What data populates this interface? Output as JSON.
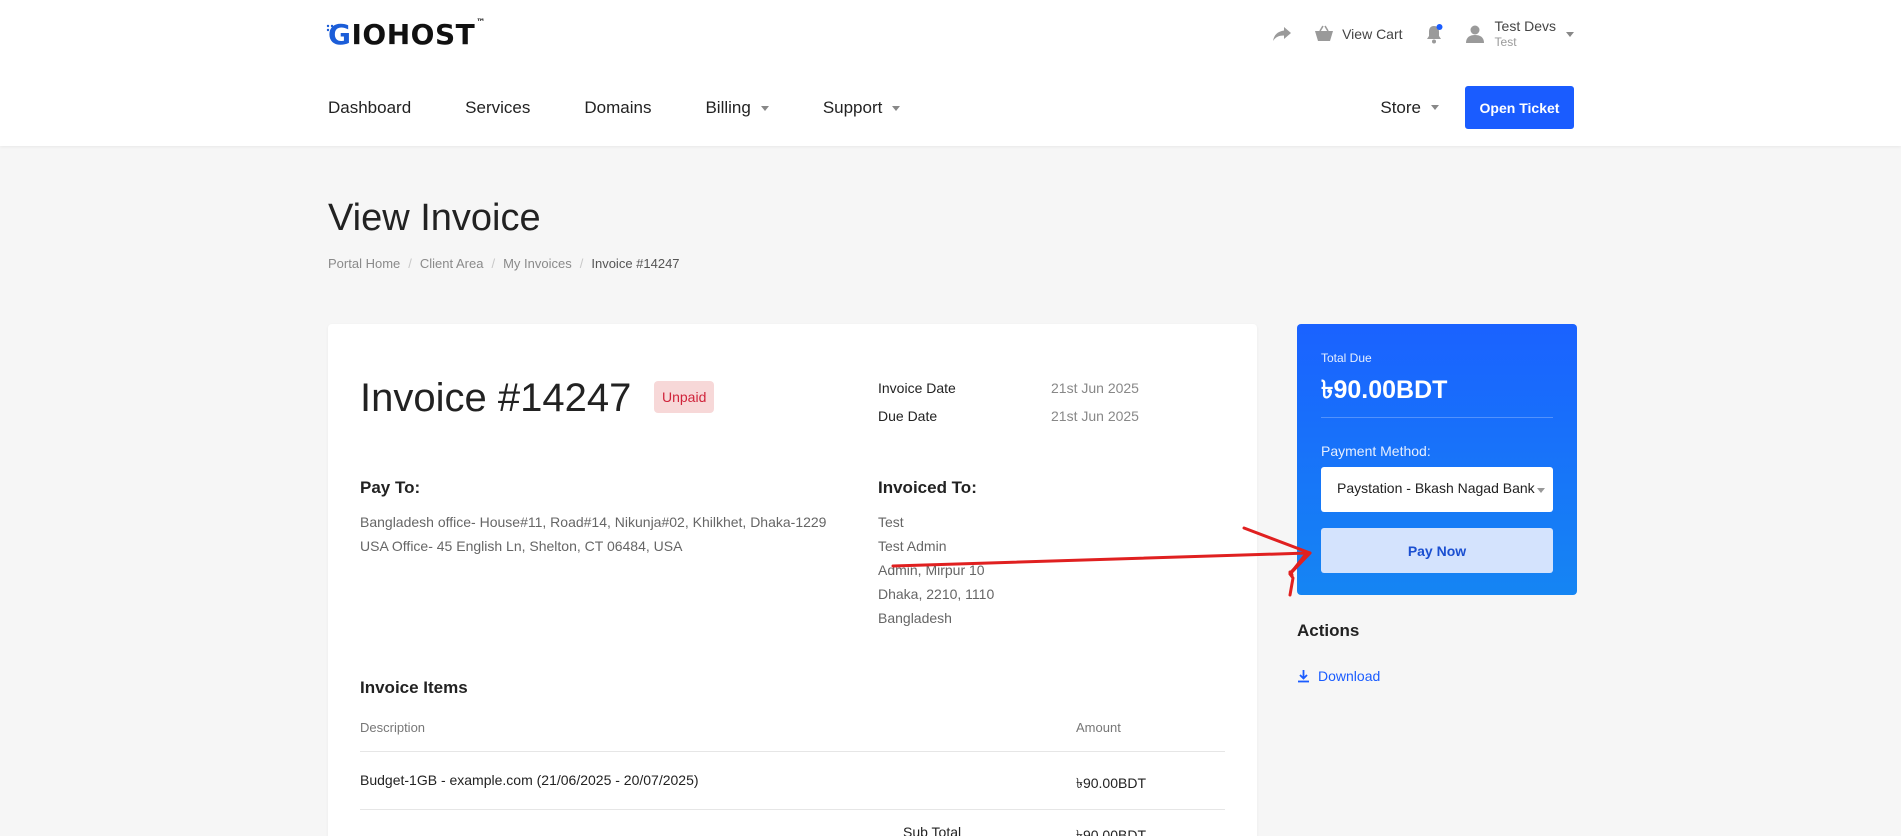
{
  "brand": {
    "logo_text": "GIOHOST",
    "logo_first_letter": "G",
    "logo_rest": "IOHOST",
    "tm": "™",
    "accent": "#1a5cff"
  },
  "header": {
    "view_cart": "View Cart",
    "user_name": "Test Devs",
    "user_sub": "Test",
    "nav": [
      "Dashboard",
      "Services",
      "Domains",
      "Billing",
      "Support"
    ],
    "store": "Store",
    "open_ticket": "Open Ticket"
  },
  "page": {
    "title": "View Invoice",
    "breadcrumb": [
      "Portal Home",
      "Client Area",
      "My Invoices",
      "Invoice #14247"
    ]
  },
  "invoice": {
    "title": "Invoice #14247",
    "status": "Unpaid",
    "invoice_date_label": "Invoice Date",
    "invoice_date": "21st Jun 2025",
    "due_date_label": "Due Date",
    "due_date": "21st Jun 2025",
    "pay_to_title": "Pay To:",
    "pay_to_lines": [
      "Bangladesh office- House#11, Road#14, Nikunja#02, Khilkhet, Dhaka-1229",
      "USA Office- 45 English Ln, Shelton, CT 06484, USA"
    ],
    "invoiced_to_title": "Invoiced To:",
    "invoiced_to_lines": [
      "Test",
      "Test Admin",
      "Admin, Mirpur 10",
      "Dhaka, 2210, 1110",
      "Bangladesh"
    ],
    "items_title": "Invoice Items",
    "col_description": "Description",
    "col_amount": "Amount",
    "items": [
      {
        "description": "Budget-1GB - example.com (21/06/2025 - 20/07/2025)",
        "amount": "৳90.00BDT"
      }
    ],
    "subtotal_label": "Sub Total",
    "subtotal": "৳90.00BDT"
  },
  "due": {
    "label": "Total Due",
    "amount": "৳90.00BDT",
    "payment_method_label": "Payment Method:",
    "payment_method": "Paystation - Bkash Nagad Bank",
    "pay_now": "Pay Now"
  },
  "actions": {
    "title": "Actions",
    "download": "Download"
  },
  "icons": [
    "share-icon",
    "cart-icon",
    "bell-icon",
    "user-icon",
    "download-icon"
  ]
}
